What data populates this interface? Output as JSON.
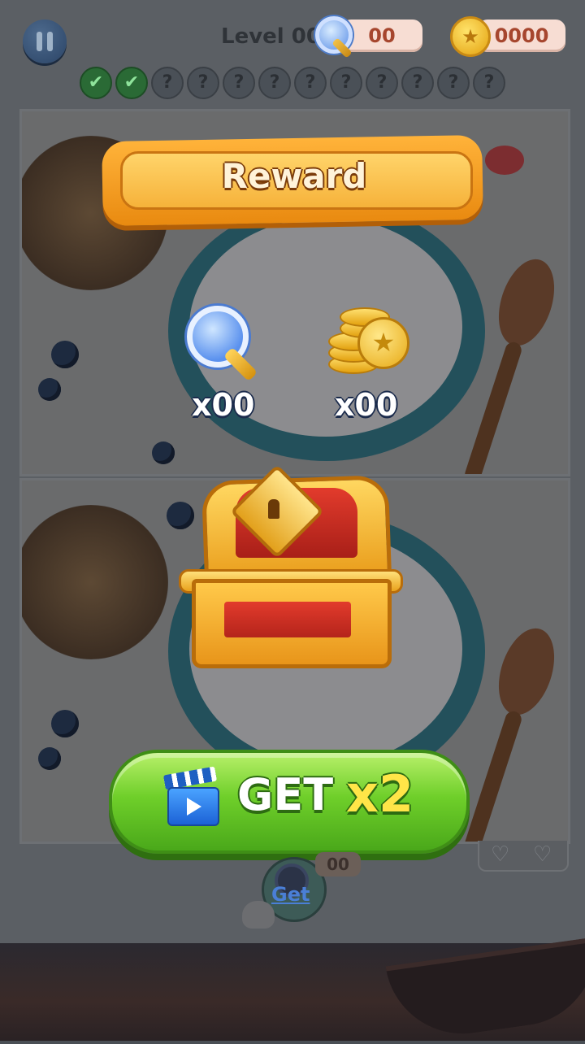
{
  "header": {
    "level_text": "Level 00",
    "hint_count": "00",
    "coin_count": "0000",
    "progress_marks": [
      "done",
      "done",
      "todo",
      "todo",
      "todo",
      "todo",
      "todo",
      "todo",
      "todo",
      "todo",
      "todo",
      "todo"
    ],
    "todo_symbol": "?",
    "done_symbol": "✔"
  },
  "reward": {
    "title": "Reward",
    "hint_amount": "x00",
    "coin_amount": "x00"
  },
  "get_button": {
    "label": "GET",
    "multiplier": "x2"
  },
  "bottom": {
    "hint_badge": "00",
    "hint_get_label": "Get",
    "heart_symbol": "♡"
  },
  "colors": {
    "banner": "#f6b23a",
    "button_green": "#6fcf2a",
    "multiplier_yellow": "#ffe548"
  }
}
